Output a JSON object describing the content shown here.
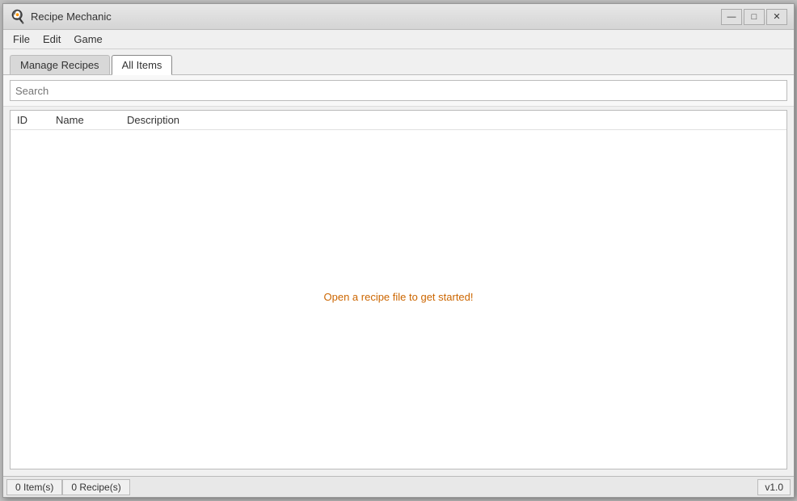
{
  "window": {
    "title": "Recipe Mechanic",
    "icon": "🍳"
  },
  "titlebar": {
    "minimize_label": "—",
    "maximize_label": "□",
    "close_label": "✕"
  },
  "menubar": {
    "items": [
      {
        "label": "File"
      },
      {
        "label": "Edit"
      },
      {
        "label": "Game"
      }
    ]
  },
  "tabs": [
    {
      "label": "Manage Recipes",
      "active": false
    },
    {
      "label": "All Items",
      "active": true
    }
  ],
  "search": {
    "placeholder": "Search",
    "value": ""
  },
  "table": {
    "columns": [
      "ID",
      "Name",
      "Description"
    ],
    "empty_message": "Open a recipe file to get started!"
  },
  "statusbar": {
    "items_count": "0 Item(s)",
    "recipes_count": "0 Recipe(s)",
    "version": "v1.0"
  }
}
